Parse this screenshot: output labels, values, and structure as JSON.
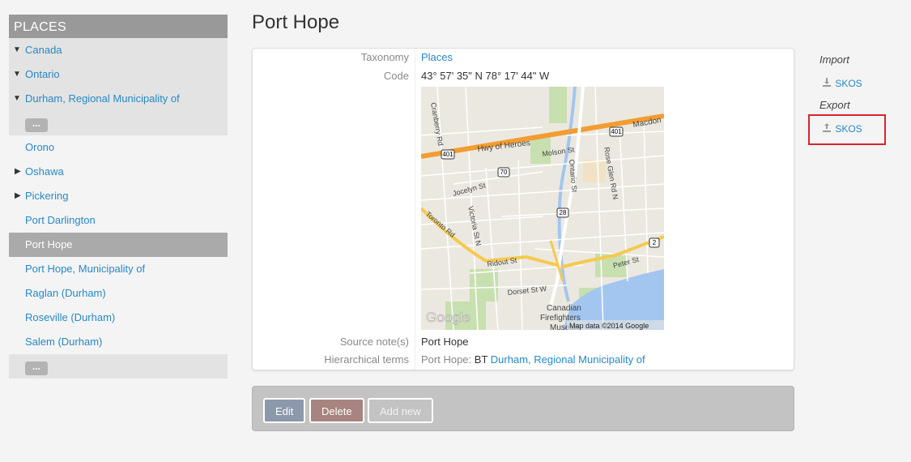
{
  "sidebar": {
    "header": "PLACES",
    "items": [
      {
        "label": "Canada",
        "expanded": true
      },
      {
        "label": "Ontario",
        "expanded": true
      },
      {
        "label": "Durham, Regional Municipality of",
        "expanded": true
      },
      {
        "more": "..."
      },
      {
        "label": "Orono"
      },
      {
        "label": "Oshawa",
        "collapsed": true
      },
      {
        "label": "Pickering",
        "collapsed": true
      },
      {
        "label": "Port Darlington"
      },
      {
        "label": "Port Hope",
        "active": true
      },
      {
        "label": "Port Hope, Municipality of"
      },
      {
        "label": "Raglan (Durham)"
      },
      {
        "label": "Roseville (Durham)"
      },
      {
        "label": "Salem (Durham)"
      },
      {
        "more": "..."
      }
    ]
  },
  "page": {
    "title": "Port Hope"
  },
  "fields": {
    "taxonomy_label": "Taxonomy",
    "taxonomy_value": "Places",
    "code_label": "Code",
    "code_value": "43° 57' 35\" N 78° 17' 44\" W",
    "source_label": "Source note(s)",
    "source_value": "Port Hope",
    "hier_label": "Hierarchical terms",
    "hier_prefix": "Port Hope:",
    "hier_bt": "BT",
    "hier_link": "Durham, Regional Municipality of"
  },
  "map": {
    "labels": [
      "Cranberry Rd",
      "Hwy of Heroes",
      "Macdon",
      "Molson St",
      "Rose Glen Rd N",
      "Ontario St",
      "Jocelyn St",
      "Victoria St N",
      "Toronto Rd",
      "Ridout St",
      "Peter St",
      "Dorset St W",
      "Canadian",
      "Firefighters",
      "Museum"
    ],
    "shields": [
      "401",
      "401",
      "70",
      "28",
      "2"
    ],
    "brand": "Google",
    "attribution": "Map data ©2014 Google"
  },
  "actions": {
    "edit": "Edit",
    "delete": "Delete",
    "add_new": "Add new"
  },
  "right": {
    "import_heading": "Import",
    "import_link": "SKOS",
    "export_heading": "Export",
    "export_link": "SKOS"
  },
  "colors": {
    "link": "#2788c5",
    "highlight": "#d9242d"
  }
}
